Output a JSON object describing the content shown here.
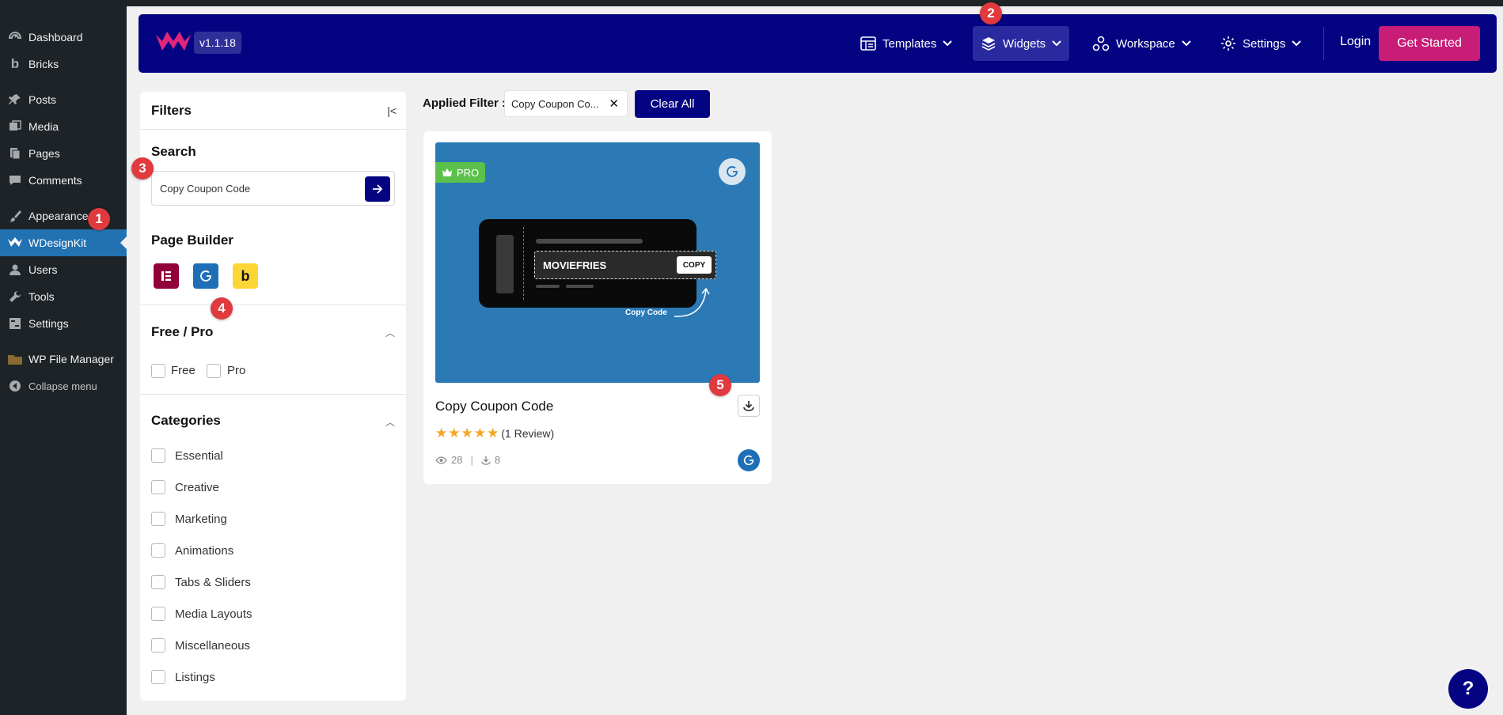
{
  "wp_menu": {
    "items": [
      {
        "label": "Dashboard",
        "icon": "dashboard-icon"
      },
      {
        "label": "Bricks",
        "icon": "bricks-icon"
      },
      {
        "label": "Posts",
        "icon": "pin-icon"
      },
      {
        "label": "Media",
        "icon": "media-icon"
      },
      {
        "label": "Pages",
        "icon": "pages-icon"
      },
      {
        "label": "Comments",
        "icon": "comments-icon"
      },
      {
        "label": "Appearance",
        "icon": "brush-icon"
      },
      {
        "label": "WDesignKit",
        "icon": "wdesignkit-icon"
      },
      {
        "label": "Users",
        "icon": "users-icon"
      },
      {
        "label": "Tools",
        "icon": "wrench-icon"
      },
      {
        "label": "Settings",
        "icon": "settings-icon"
      },
      {
        "label": "WP File Manager",
        "icon": "file-manager-icon"
      },
      {
        "label": "Collapse menu",
        "icon": "collapse-icon"
      }
    ],
    "active": "WDesignKit"
  },
  "annotations": [
    "1",
    "2",
    "3",
    "4",
    "5"
  ],
  "header": {
    "version": "v1.1.18",
    "nav": [
      {
        "label": "Templates",
        "icon": "templates-icon"
      },
      {
        "label": "Widgets",
        "icon": "layers-icon"
      },
      {
        "label": "Workspace",
        "icon": "workspace-icon"
      },
      {
        "label": "Settings",
        "icon": "gear-icon"
      }
    ],
    "login": "Login",
    "get_started": "Get Started",
    "colors": {
      "bg": "#040483",
      "accent": "#c81d77"
    }
  },
  "filters": {
    "title": "Filters",
    "search": {
      "title": "Search",
      "value": "Copy Coupon Code"
    },
    "page_builder": {
      "title": "Page Builder",
      "builders": [
        "elementor-icon",
        "gutenberg-icon",
        "bricks-icon"
      ]
    },
    "free_pro": {
      "title": "Free / Pro",
      "options": [
        "Free",
        "Pro"
      ]
    },
    "categories": {
      "title": "Categories",
      "options": [
        "Essential",
        "Creative",
        "Marketing",
        "Animations",
        "Tabs & Sliders",
        "Media Layouts",
        "Miscellaneous",
        "Listings"
      ]
    }
  },
  "applied": {
    "label": "Applied Filter :",
    "chip": "Copy Coupon Co...",
    "clear_all": "Clear All"
  },
  "card": {
    "badge": "PRO",
    "coupon_code": "MOVIEFRIES",
    "copy_label": "COPY",
    "copy_hint": "Copy Code",
    "title": "Copy Coupon Code",
    "rating": 5,
    "review": "(1 Review)",
    "views": "28",
    "separator": "|",
    "downloads": "8"
  },
  "help": "?"
}
